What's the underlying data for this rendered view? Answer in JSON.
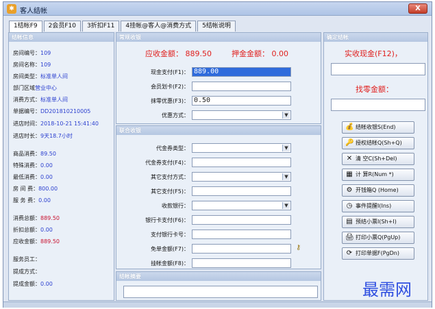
{
  "window": {
    "title": "客人结帐",
    "close_label": "X"
  },
  "tabs": [
    {
      "label": "1结帐F9",
      "active": true
    },
    {
      "label": "2会员F10",
      "active": false
    },
    {
      "label": "3折扣F11",
      "active": false
    },
    {
      "label": "4挂帐@客人@消费方式",
      "active": false
    },
    {
      "label": "5结帐说明",
      "active": false
    }
  ],
  "info": {
    "header": "结帐信息",
    "rows": [
      {
        "label": "房间编号：",
        "value": "109"
      },
      {
        "label": "房间名称：",
        "value": "109"
      },
      {
        "label": "房间类型：",
        "value": "标准单人间"
      },
      {
        "label": "部门区域",
        "value": "营业中心"
      },
      {
        "label": "消费方式：",
        "value": "标准单人间"
      },
      {
        "label": "单据编号：",
        "value": "DD201810210005"
      },
      {
        "label": "进店时间：",
        "value": "2018-10-21 15:41:40"
      },
      {
        "label": "进店时长：",
        "value": "9天18.7小时"
      },
      {
        "label": "商品消费：",
        "value": "89.50"
      },
      {
        "label": "特殊消费：",
        "value": "0.00"
      },
      {
        "label": "最低消费：",
        "value": "0.00"
      },
      {
        "label": "房 间 费：",
        "value": "800.00"
      },
      {
        "label": "服 务 费：",
        "value": "0.00"
      },
      {
        "label": "消费总额：",
        "value": "889.50"
      },
      {
        "label": "折扣总额：",
        "value": "0.00"
      },
      {
        "label": "应收金额：",
        "value": "889.50"
      },
      {
        "label": "服务员工：",
        "value": ""
      },
      {
        "label": "提成方式：",
        "value": ""
      },
      {
        "label": "提成金额：",
        "value": "0.00"
      }
    ]
  },
  "normal": {
    "header": "常规收银",
    "receivable_label": "应收金额：",
    "receivable_value": "889.50",
    "deposit_label": "押金金额：",
    "deposit_value": "0.00",
    "cash_label": "现金支付(F1)：",
    "cash_value": "889.00",
    "member_label": "会员划卡(F2)：",
    "member_value": "",
    "rounding_label": "抹零优惠(F3)：",
    "rounding_value": "0.50",
    "discount_method_label": "优惠方式：",
    "discount_method_value": ""
  },
  "joint": {
    "header": "联合收银",
    "voucher_type_label": "代金券类型：",
    "voucher_pay_label": "代金券支付(F4)：",
    "other_method_label": "其它支付方式：",
    "other_pay_label": "其它支付(F5)：",
    "bank_label": "收款银行：",
    "bank_card_label": "银行卡支付(F6)：",
    "card_no_label": "支付银行卡号：",
    "free_label": "免单金额(F7)：",
    "credit_label": "挂帐金额(F8)："
  },
  "summary": {
    "header": "结帐摘要",
    "value": ""
  },
  "confirm": {
    "header": "确定结帐",
    "cash_title": "实收现金(F12)，",
    "change_title": "找零金额："
  },
  "buttons": [
    {
      "name": "checkout-button",
      "icon": "💰",
      "icon_name": "money-bag-icon",
      "label": "结帐收银S(End)"
    },
    {
      "name": "authorized-checkout-button",
      "icon": "🔑",
      "icon_name": "key-icon",
      "label": "授权结帐Q(Sh+Q)"
    },
    {
      "name": "clear-button",
      "icon": "✕",
      "icon_name": "red-x-icon",
      "label": "清    空C(Sh+Del)"
    },
    {
      "name": "calculator-button",
      "icon": "▦",
      "icon_name": "calculator-icon",
      "label": "计    算R(Num *)"
    },
    {
      "name": "open-cashbox-button",
      "icon": "⚙",
      "icon_name": "cashbox-icon",
      "label": "开钱箱Q (Home)"
    },
    {
      "name": "event-reminder-button",
      "icon": "◷",
      "icon_name": "clock-icon",
      "label": "事件提醒I(Ins)"
    },
    {
      "name": "pre-print-receipt-button",
      "icon": "▤",
      "icon_name": "receipt-icon",
      "label": "预结小票I(Sh+I)"
    },
    {
      "name": "print-receipt-button",
      "icon": "🖨",
      "icon_name": "printer-icon",
      "label": "打印小票Q(PgUp)"
    },
    {
      "name": "print-invoice-button",
      "icon": "⟳",
      "icon_name": "print-cycle-icon",
      "label": "打印单据F(PgDn)"
    }
  ],
  "watermark": "最需网",
  "colors": {
    "accent_red": "#e0201e",
    "value_blue": "#2b3fcf",
    "selection": "#2f6bdc"
  }
}
